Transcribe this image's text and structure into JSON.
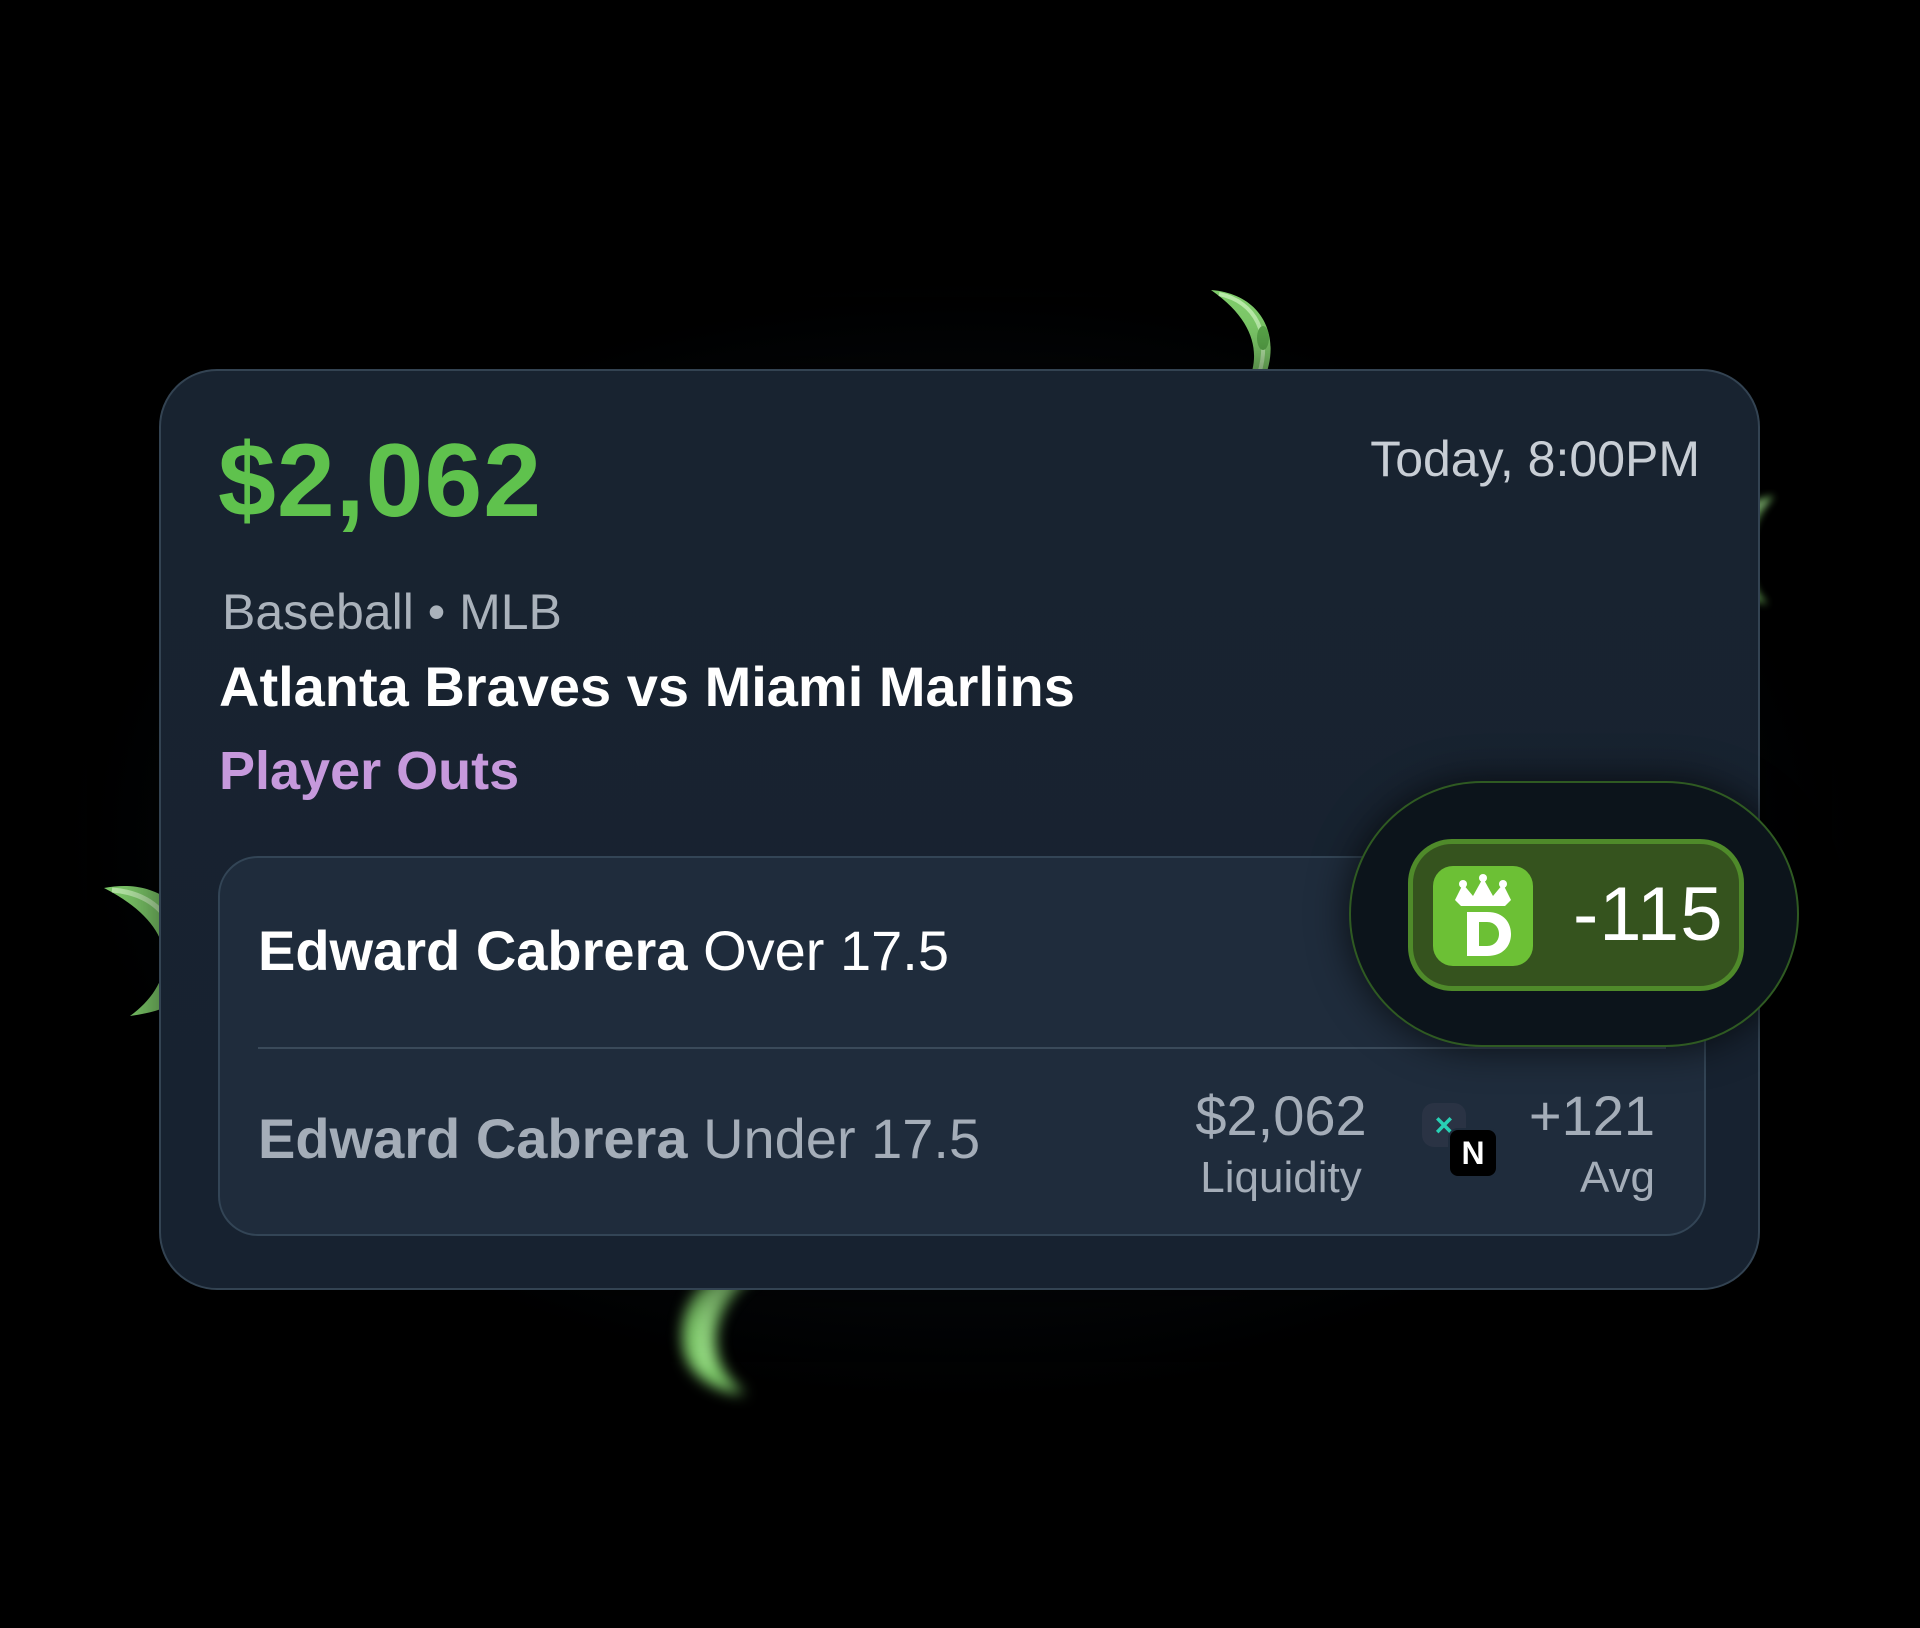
{
  "bet": {
    "amount": "$2,062",
    "datetime": "Today, 8:00PM",
    "sport_league": "Baseball • MLB",
    "matchup": "Atlanta Braves vs Miami Marlins",
    "market": "Player Outs"
  },
  "selections": [
    {
      "player": "Edward Cabrera",
      "line": "Over 17.5",
      "book": "DraftKings",
      "odds": "-115",
      "selected": true
    },
    {
      "player": "Edward Cabrera",
      "line": "Under 17.5",
      "liquidity_value": "$2,062",
      "liquidity_label": "Liquidity",
      "avg_value": "+121",
      "avg_label": "Avg"
    }
  ],
  "colors": {
    "amount": "#5fc24d",
    "market": "#c699dc",
    "card": "#182330",
    "selected_odds": "#35531e",
    "draftkings": "#6cc035"
  },
  "icons": [
    "draftkings-logo-icon",
    "book-x-icon",
    "book-n-icon",
    "money-leaf-icon"
  ]
}
